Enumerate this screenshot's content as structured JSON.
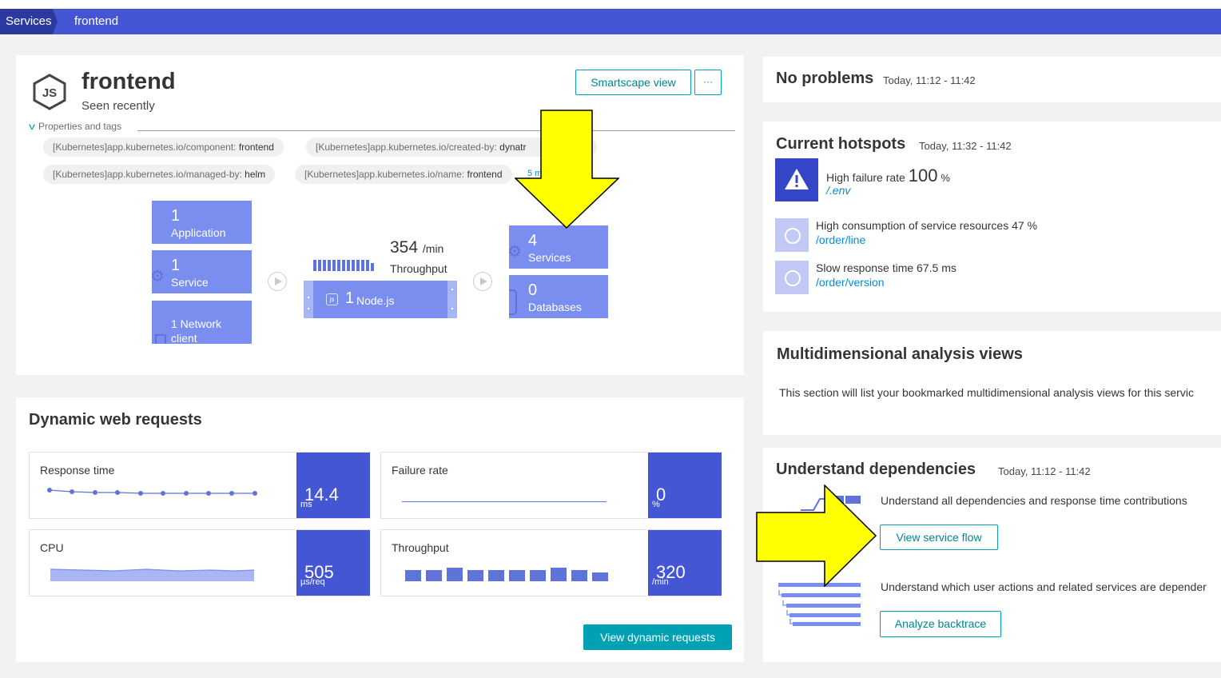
{
  "breadcrumb": {
    "root": "Services",
    "current": "frontend"
  },
  "header": {
    "title": "frontend",
    "subtitle": "Seen recently",
    "smartscape_label": "Smartscape view",
    "more_label": "···",
    "properties_label": "Properties and tags",
    "tags": [
      {
        "key": "[Kubernetes]app.kubernetes.io/component:",
        "value": "frontend"
      },
      {
        "key": "[Kubernetes]app.kubernetes.io/created-by:",
        "value": "dynatr"
      },
      {
        "key": "[Kubernetes]app.kubernetes.io/managed-by:",
        "value": "helm"
      },
      {
        "key": "[Kubernetes]app.kubernetes.io/name:",
        "value": "frontend"
      }
    ],
    "more_tags": "5 m"
  },
  "topology": {
    "callers": [
      {
        "count": "1",
        "label": "Application"
      },
      {
        "count": "1",
        "label": "Service"
      },
      {
        "count": "",
        "label": "1 Network client"
      }
    ],
    "throughput_value": "354",
    "throughput_unit": "/min",
    "throughput_label": "Throughput",
    "process": {
      "count": "1",
      "label": "Node.js",
      "icon": "js"
    },
    "callees": [
      {
        "count": "4",
        "label": "Services"
      },
      {
        "count": "0",
        "label": "Databases"
      }
    ]
  },
  "problems": {
    "title": "No problems",
    "time": "Today, 11:12 - 11:42"
  },
  "hotspots": {
    "title": "Current hotspots",
    "time": "Today, 11:32 - 11:42",
    "items": [
      {
        "text": "High failure rate",
        "value": "100",
        "unit": "%",
        "link": "/.env"
      },
      {
        "text": "High consumption of service resources 47 %",
        "link": "/order/line"
      },
      {
        "text": "Slow response time 67.5 ms",
        "link": "/order/version"
      }
    ]
  },
  "mda": {
    "title": "Multidimensional analysis views",
    "text": "This section will list your bookmarked multidimensional analysis views for this servic"
  },
  "dependencies": {
    "title": "Understand dependencies",
    "time": "Today, 11:12 - 11:42",
    "flow_text": "Understand all dependencies and response time contributions",
    "flow_button": "View service flow",
    "backtrace_text": "Understand which user actions and related services are depender",
    "backtrace_button": "Analyze backtrace"
  },
  "dynamic": {
    "title": "Dynamic web requests",
    "metrics": [
      {
        "title": "Response time",
        "value": "14.4",
        "unit": "ms"
      },
      {
        "title": "Failure rate",
        "value": "0",
        "unit": "%"
      },
      {
        "title": "CPU",
        "value": "505",
        "unit": "µs/req"
      },
      {
        "title": "Throughput",
        "value": "320",
        "unit": "/min"
      }
    ],
    "button": "View dynamic requests"
  },
  "colors": {
    "accent": "#4556d4",
    "tile": "#7a8eef",
    "teal": "#00a1b2",
    "highlight": "#ffff00"
  }
}
